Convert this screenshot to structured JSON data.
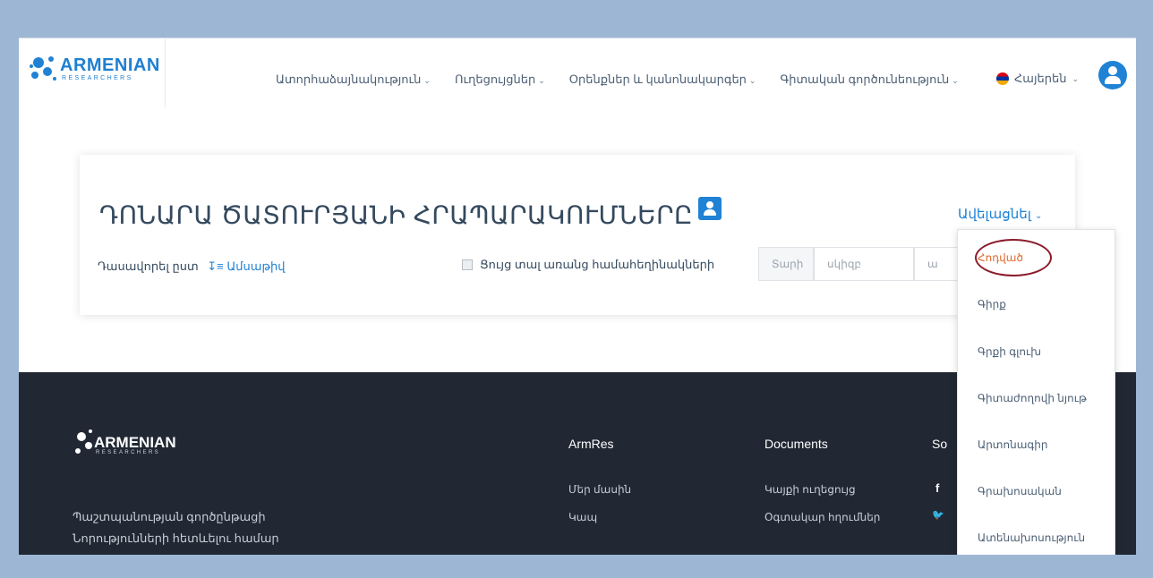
{
  "header": {
    "logo_text": "ARMENIAN",
    "logo_sub": "RESEARCHERS",
    "nav": [
      {
        "label": "Ատորհաձայնակություն",
        "chev": "⌄"
      },
      {
        "label": "Ուղեցույցներ",
        "chev": "⌄"
      },
      {
        "label": "Օրենքներ և կանոնակարգեր",
        "chev": "⌄"
      },
      {
        "label": "Գիտական գործունեություն",
        "chev": "⌄"
      }
    ],
    "language": "Հայերեն",
    "language_chev": "⌄"
  },
  "card": {
    "title": "ԴՈՆԱՐԱ ԾԱՏՈՒՐՅԱՆԻ ՀՐԱՊԱՐԱԿՈՒՄՆԵՐԸ",
    "add_label": "Ավելացնել",
    "add_chev": "⌄",
    "sort_label": "Դասավորել ըստ",
    "sort_icon": "↧≡",
    "sort_value": "Ամսաթիվ",
    "checkbox_label": "Ցույց տալ առանց համահեղինակների",
    "inputs": {
      "type": "Տարի",
      "start": "սկիզբ",
      "end": "ա"
    }
  },
  "dropdown": {
    "items": [
      "Հոդված",
      "Գիրք",
      "Գրքի գլուխ",
      "Գիտաժողովի նյութ",
      "Արտոնագիր",
      "Գրախոսական",
      "Ատենախոսություն"
    ]
  },
  "footer": {
    "logo_text": "ARMENIAN",
    "logo_sub": "RESEARCHERS",
    "text_line1": "Պաշտպանության գործընթացի",
    "text_line2": "Նորությունների հետևելու համար",
    "col1": {
      "title": "ArmRes",
      "items": [
        "Մեր մասին",
        "Կապ"
      ]
    },
    "col2": {
      "title": "Documents",
      "items": [
        "Կայքի ուղեցույց",
        "Օգտակար հղումներ"
      ]
    },
    "col3": {
      "title": "So"
    },
    "social_icons": [
      "f",
      "🐦"
    ]
  },
  "colors": {
    "accent": "#1f82d4",
    "footer_bg": "#212834",
    "highlight": "#e1672d",
    "annotation": "#8b1b2b"
  }
}
